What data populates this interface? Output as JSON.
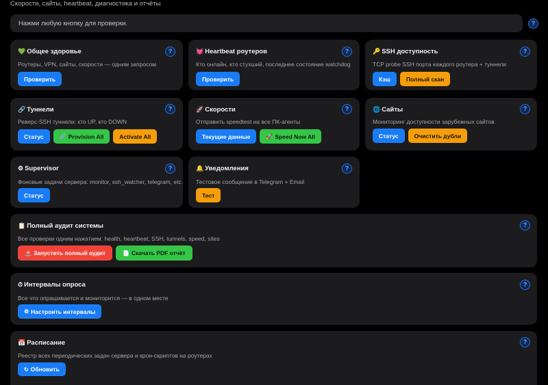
{
  "page": {
    "subtitle": "Скорости, сайты, heartbeat, диагностика и отчёты"
  },
  "status": {
    "text": "Нажми любую кнопку для проверки.",
    "help": "?"
  },
  "cards": {
    "health": {
      "icon": "💚",
      "title": "Общее здоровье",
      "desc": "Роутеры, VPN, сайты, скорости — одним запросом",
      "buttons": [
        "Проверить"
      ]
    },
    "heartbeat": {
      "icon": "💓",
      "title": "Heartbeat роутеров",
      "desc": "Кто онлайн, кто стухший, последнее состояние watchdog",
      "buttons": [
        "Проверить"
      ]
    },
    "ssh": {
      "icon": "🔑",
      "title": "SSH доступность",
      "desc": "TCP probe SSH порта каждого роутера + туннели",
      "buttons": [
        "Кэш",
        "Полный скан"
      ]
    },
    "tunnels": {
      "icon": "🔗",
      "title": "Туннели",
      "desc": "Реверс-SSH туннели: кто UP, кто DOWN",
      "buttons": [
        "Статус",
        "Provision All",
        "Activate All"
      ]
    },
    "speeds": {
      "icon": "🚀",
      "title": "Скорости",
      "desc": "Отправить speedtest на все ПК-агенты",
      "buttons": [
        "Текущие данные",
        "Speed Now All"
      ]
    },
    "sites": {
      "icon": "🌐",
      "title": "Сайты",
      "desc": "Мониторинг доступности зарубежных сайтов",
      "buttons": [
        "Статус",
        "Очистить дубли"
      ]
    },
    "supervisor": {
      "icon": "⚙",
      "title": "Supervisor",
      "desc": "Фоновые задачи сервера: monitor, ssh_watcher, telegram, etc.",
      "buttons": [
        "Статус"
      ]
    },
    "notify": {
      "icon": "🔔",
      "title": "Уведомления",
      "desc": "Тестовое сообщение в Telegram + Email",
      "buttons": [
        "Тест"
      ]
    },
    "audit": {
      "icon": "📋",
      "title": "Полный аудит системы",
      "desc": "Все проверки одним нажатием: health, heartbeat, SSH, tunnels, speed, sites",
      "buttons": [
        "Запустить полный аудит",
        "Скачать PDF отчёт"
      ]
    },
    "intervals": {
      "icon": "⏱",
      "title": "Интервалы опроса",
      "desc": "Все что опрашивается и мониторится — в одном месте",
      "buttons": [
        "Настроить интервалы"
      ]
    },
    "schedule": {
      "icon": "📅",
      "title": "Расписание",
      "desc": "Реестр всех периодических задач сервера и крон-скриптов на роутерах",
      "buttons": [
        "Обновить"
      ]
    }
  },
  "button_icons": {
    "provision": "🔗",
    "speed_now": "🚀",
    "audit": "🚨",
    "pdf": "📄",
    "intervals": "⚙",
    "refresh": "↻"
  },
  "colors": {
    "background": "#000000",
    "card": "#1c1c1f",
    "blue": "#1a7cf5",
    "green": "#35c547",
    "orange": "#f59e0b",
    "red": "#f0443a"
  }
}
